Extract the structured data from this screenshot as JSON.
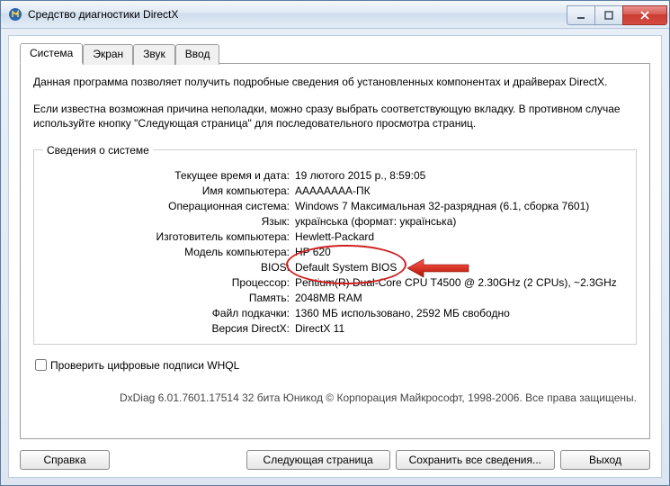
{
  "window": {
    "title": "Средство диагностики DirectX"
  },
  "tabs": {
    "system": "Система",
    "display": "Экран",
    "sound": "Звук",
    "input": "Ввод"
  },
  "intro": {
    "p1": "Данная программа позволяет получить подробные сведения об установленных компонентах и драйверах DirectX.",
    "p2": "Если известна возможная причина неполадки, можно сразу выбрать соответствующую вкладку. В противном случае используйте кнопку \"Следующая страница\" для последовательного просмотра страниц."
  },
  "sysinfo": {
    "legend": "Сведения о системе",
    "rows": {
      "datetime_lbl": "Текущее время и дата:",
      "datetime_val": "19 лютого 2015 р., 8:59:05",
      "pcname_lbl": "Имя компьютера:",
      "pcname_val": "АААААААА-ПК",
      "os_lbl": "Операционная система:",
      "os_val": "Windows 7 Максимальная 32-разрядная (6.1, сборка 7601)",
      "lang_lbl": "Язык:",
      "lang_val": "українська (формат: українська)",
      "mfr_lbl": "Изготовитель компьютера:",
      "mfr_val": "Hewlett-Packard",
      "model_lbl": "Модель компьютера:",
      "model_val": "HP 620",
      "bios_lbl": "BIOS:",
      "bios_val": "Default System BIOS",
      "cpu_lbl": "Процессор:",
      "cpu_val": "Pentium(R) Dual-Core CPU       T4500  @ 2.30GHz (2 CPUs), ~2.3GHz",
      "mem_lbl": "Память:",
      "mem_val": "2048MB RAM",
      "page_lbl": "Файл подкачки:",
      "page_val": "1360 МБ использовано, 2592 МБ свободно",
      "dx_lbl": "Версия DirectX:",
      "dx_val": "DirectX 11"
    }
  },
  "whql": {
    "label": "Проверить цифровые подписи WHQL"
  },
  "footer": "DxDiag 6.01.7601.17514 32 бита Юникод  © Корпорация Майкрософт, 1998-2006.  Все права защищены.",
  "buttons": {
    "help": "Справка",
    "next": "Следующая страница",
    "save": "Сохранить все сведения...",
    "exit": "Выход"
  }
}
